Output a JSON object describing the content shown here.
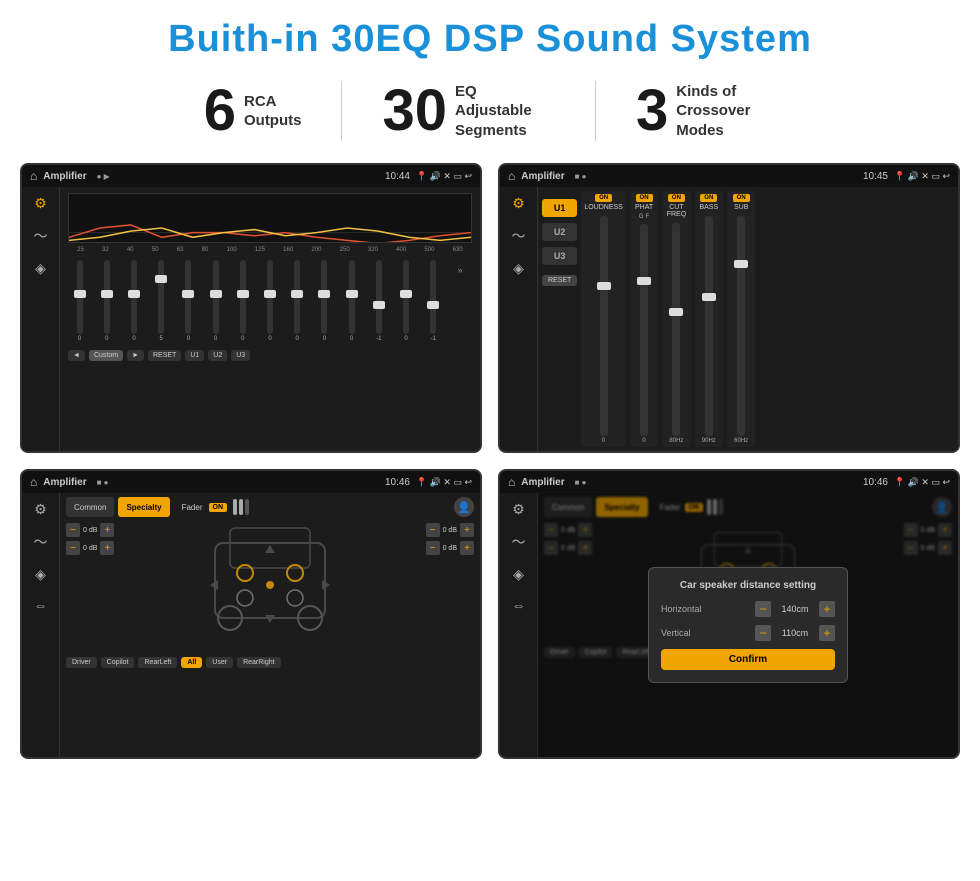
{
  "header": {
    "title": "Buith-in 30EQ DSP Sound System"
  },
  "stats": [
    {
      "number": "6",
      "label": "RCA\nOutputs"
    },
    {
      "number": "30",
      "label": "EQ Adjustable\nSegments"
    },
    {
      "number": "3",
      "label": "Kinds of\nCrossover Modes"
    }
  ],
  "screens": [
    {
      "id": "eq-screen",
      "statusBar": {
        "appName": "Amplifier",
        "time": "10:44"
      },
      "eqValues": [
        "0",
        "0",
        "0",
        "5",
        "0",
        "0",
        "0",
        "0",
        "0",
        "0",
        "0",
        "-1",
        "0",
        "-1"
      ],
      "freqLabels": [
        "25",
        "32",
        "40",
        "50",
        "63",
        "80",
        "100",
        "125",
        "160",
        "200",
        "250",
        "320",
        "400",
        "500",
        "630"
      ],
      "presetLabel": "Custom",
      "buttons": [
        "◄",
        "Custom",
        "►",
        "RESET",
        "U1",
        "U2",
        "U3"
      ]
    },
    {
      "id": "crossover-screen",
      "statusBar": {
        "appName": "Amplifier",
        "time": "10:45"
      },
      "uButtons": [
        "U1",
        "U2",
        "U3"
      ],
      "channels": [
        {
          "name": "LOUDNESS",
          "on": true
        },
        {
          "name": "PHAT",
          "on": true
        },
        {
          "name": "CUT FREQ",
          "on": true
        },
        {
          "name": "BASS",
          "on": true
        },
        {
          "name": "SUB",
          "on": true
        }
      ]
    },
    {
      "id": "speaker-screen",
      "statusBar": {
        "appName": "Amplifier",
        "time": "10:46"
      },
      "tabs": [
        "Common",
        "Specialty"
      ],
      "activeTab": "Specialty",
      "faderLabel": "Fader",
      "faderOn": "ON",
      "dbValues": [
        "0 dB",
        "0 dB",
        "0 dB",
        "0 dB"
      ],
      "buttons": [
        "Driver",
        "Copilot",
        "RearLeft",
        "All",
        "User",
        "RearRight"
      ]
    },
    {
      "id": "dialog-screen",
      "statusBar": {
        "appName": "Amplifier",
        "time": "10:46"
      },
      "tabs": [
        "Common",
        "Specialty"
      ],
      "activeTab": "Specialty",
      "dialog": {
        "title": "Car speaker distance setting",
        "horizontalLabel": "Horizontal",
        "horizontalValue": "140cm",
        "verticalLabel": "Vertical",
        "verticalValue": "110cm",
        "confirmLabel": "Confirm"
      },
      "dbValues": [
        "0 dB",
        "0 dB"
      ],
      "buttons": [
        "Driver",
        "Copilot",
        "RearLeft",
        "All",
        "User",
        "RearRight"
      ]
    }
  ]
}
